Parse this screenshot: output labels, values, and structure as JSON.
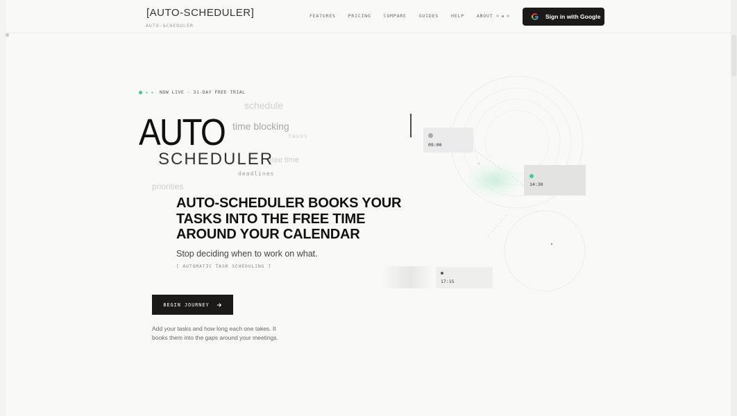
{
  "header": {
    "logo": "[AUTO-SCHEDULER]",
    "logo_sub": "AUTO-SCHEDULER",
    "nav": [
      "FEATURES",
      "PRICING",
      "COMPARE",
      "GUIDES",
      "HELP",
      "ABOUT"
    ],
    "signin_label": "Sign in with Google"
  },
  "hero": {
    "badge": "NOW LIVE · 31-DAY FREE TRIAL",
    "title_line1": "AUTO",
    "title_line2": "SCHEDULER",
    "floating_words": {
      "schedule": "schedule",
      "time_blocking": "time blocking",
      "tasks": "tasks",
      "free_time": "free time",
      "deadlines": "deadlines",
      "priorities": "priorities"
    },
    "headline": "AUTO-SCHEDULER BOOKS YOUR TASKS INTO THE FREE TIME AROUND YOUR CALENDAR",
    "subline": "Stop deciding when to work on what.",
    "bracket_tag": "[ AUTOMATIC TASK SCHEDULING ]",
    "cta_label": "BEGIN JOURNEY",
    "description": "Add your tasks and how long each one takes. It books them into the gaps around your meetings."
  },
  "visual": {
    "times": [
      "09:00",
      "14:30",
      "17:15"
    ]
  },
  "colors": {
    "accent": "#3ecf8e",
    "dark": "#1c1a18",
    "background": "#f9f9f7"
  }
}
